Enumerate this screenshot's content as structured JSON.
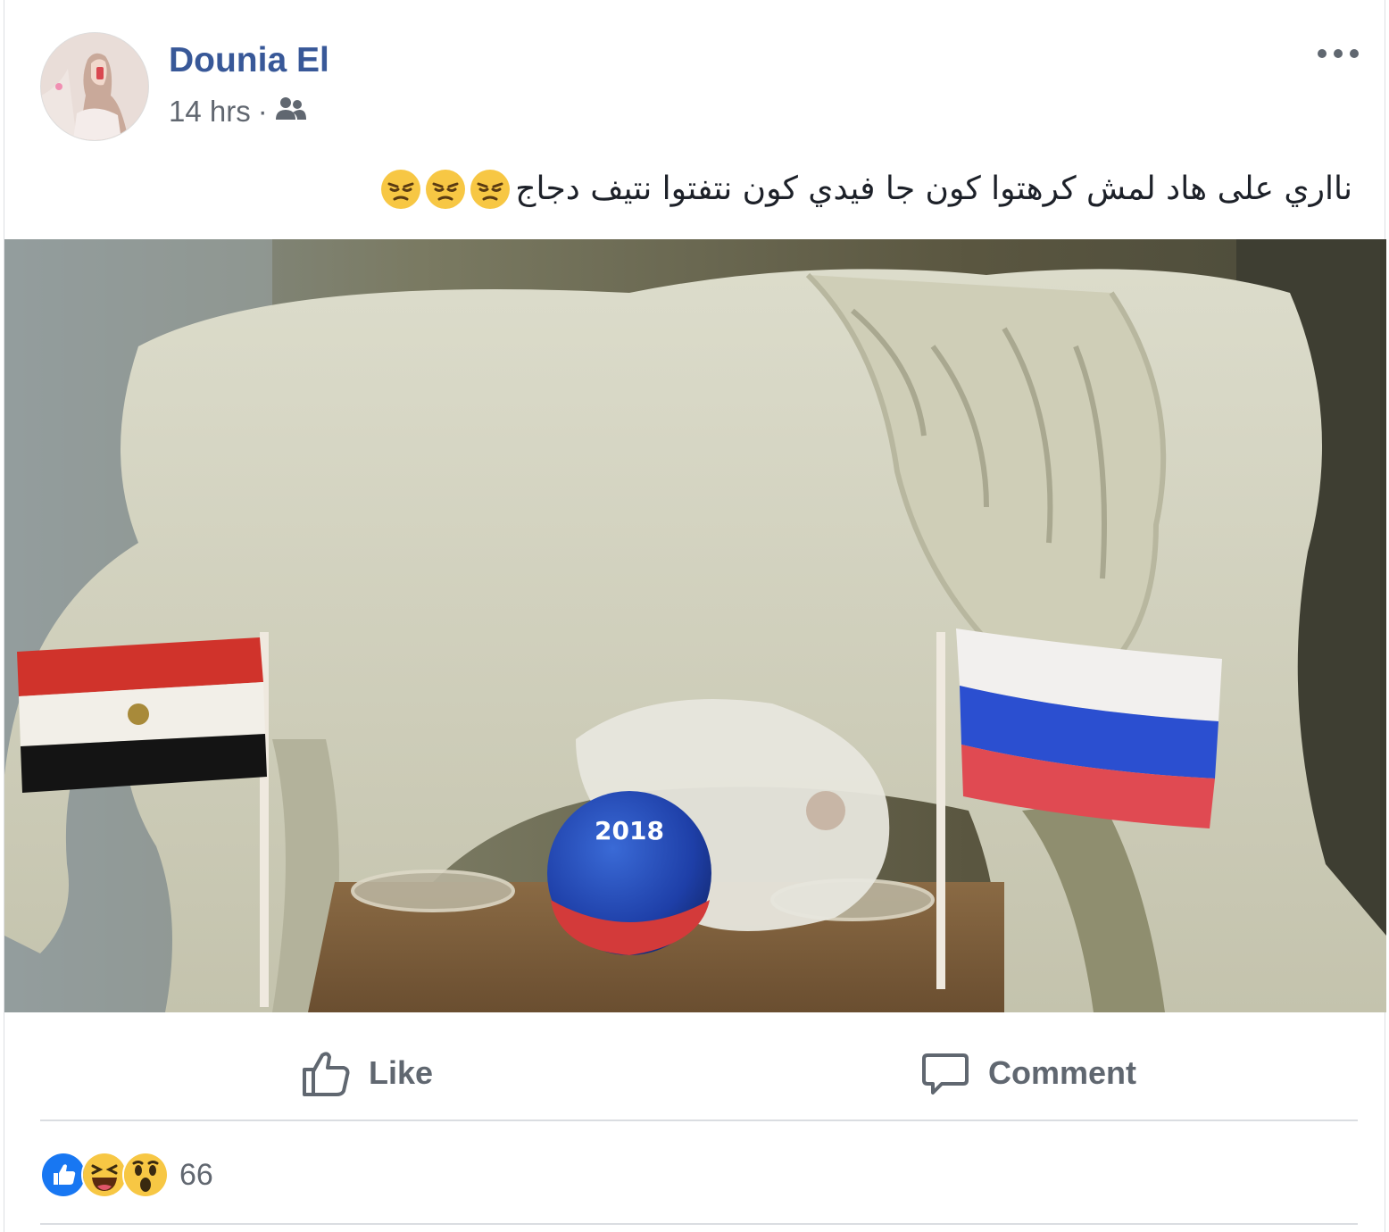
{
  "post": {
    "author": "Dounia El",
    "time": "14 hrs",
    "separator": "·",
    "audience_icon": "friends-icon",
    "text": "نااري على هاد لمش كرهتوا كون جا فيدي كون نتفتوا نتيف دجاج",
    "text_emojis": [
      "angry-face",
      "angry-face",
      "angry-face"
    ],
    "more_icon": "more-options-icon"
  },
  "actions": {
    "like_label": "Like",
    "comment_label": "Comment"
  },
  "reactions": {
    "types": [
      "like",
      "haha",
      "wow"
    ],
    "count": "66"
  },
  "colors": {
    "author": "#385898",
    "meta": "#616770",
    "text": "#1d2129",
    "action": "#606770",
    "like_blue": "#1877f2"
  }
}
